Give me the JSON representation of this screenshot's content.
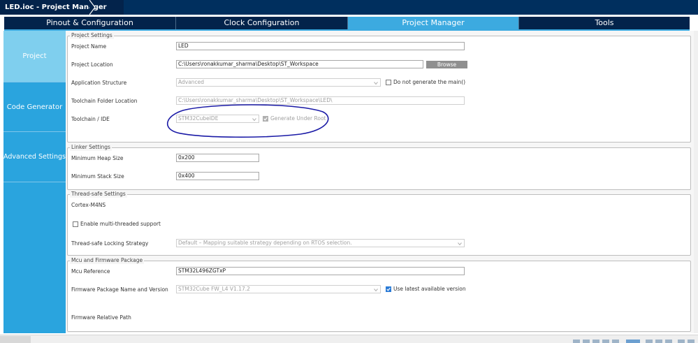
{
  "window": {
    "breadcrumb": "LED.ioc - Project Manager"
  },
  "tabs": [
    {
      "label": "Pinout & Configuration"
    },
    {
      "label": "Clock Configuration"
    },
    {
      "label": "Project Manager"
    },
    {
      "label": "Tools"
    }
  ],
  "sidebar": {
    "items": [
      {
        "label": "Project"
      },
      {
        "label": "Code Generator"
      },
      {
        "label": "Advanced Settings"
      }
    ]
  },
  "project_settings": {
    "legend": "Project Settings",
    "project_name_label": "Project Name",
    "project_name_value": "LED",
    "project_location_label": "Project Location",
    "project_location_value": "C:\\Users\\ronakkumar_sharma\\Desktop\\ST_Workspace",
    "browse_label": "Browse",
    "app_structure_label": "Application Structure",
    "app_structure_value": "Advanced",
    "no_main_label": "Do not generate the main()",
    "toolchain_folder_label": "Toolchain Folder Location",
    "toolchain_folder_value": "C:\\Users\\ronakkumar_sharma\\Desktop\\ST_Workspace\\LED\\",
    "toolchain_ide_label": "Toolchain / IDE",
    "toolchain_ide_value": "STM32CubeIDE",
    "generate_under_root_label": "Generate Under Root"
  },
  "linker_settings": {
    "legend": "Linker Settings",
    "heap_label": "Minimum Heap Size",
    "heap_value": "0x200",
    "stack_label": "Minimum Stack Size",
    "stack_value": "0x400"
  },
  "thread_safe": {
    "legend": "Thread-safe Settings",
    "core_label": "Cortex-M4NS",
    "multithread_label": "Enable multi-threaded support",
    "locking_label": "Thread-safe Locking Strategy",
    "locking_value": "Default – Mapping suitable strategy depending on RTOS selection."
  },
  "mcu_firmware": {
    "legend": "Mcu and Firmware Package",
    "mcu_ref_label": "Mcu Reference",
    "mcu_ref_value": "STM32L496ZGTxP",
    "fw_pkg_label": "Firmware Package Name and Version",
    "fw_pkg_value": "STM32Cube FW_L4 V1.17.2",
    "latest_label": "Use latest available version",
    "fw_rel_path_label": "Firmware Relative Path"
  },
  "colors": {
    "header_dark": "#03234b",
    "accent": "#3caae0",
    "sidebar": "#2aa4de",
    "annotation": "#1a1aa6"
  }
}
